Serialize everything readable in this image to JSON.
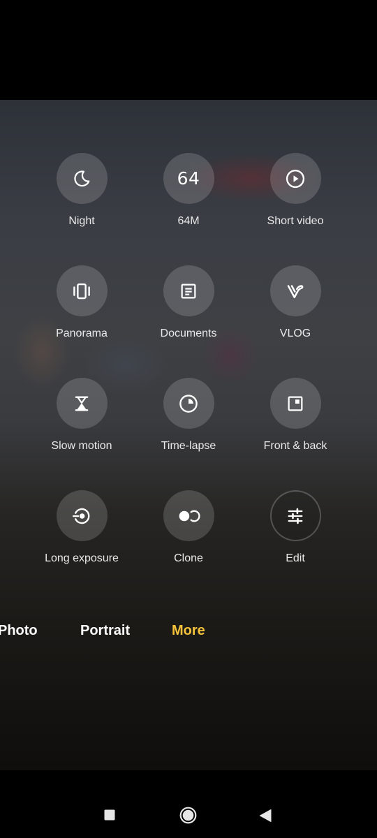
{
  "modes": [
    {
      "label": "Night",
      "icon": "moon-icon"
    },
    {
      "label": "64M",
      "icon": "64-icon",
      "icon_text": "64"
    },
    {
      "label": "Short video",
      "icon": "play-circle-icon"
    },
    {
      "label": "Panorama",
      "icon": "panorama-icon"
    },
    {
      "label": "Documents",
      "icon": "document-icon"
    },
    {
      "label": "VLOG",
      "icon": "vlog-icon"
    },
    {
      "label": "Slow motion",
      "icon": "hourglass-icon"
    },
    {
      "label": "Time-lapse",
      "icon": "timelapse-icon"
    },
    {
      "label": "Front & back",
      "icon": "front-back-icon"
    },
    {
      "label": "Long exposure",
      "icon": "long-exposure-icon"
    },
    {
      "label": "Clone",
      "icon": "clone-icon"
    },
    {
      "label": "Edit",
      "icon": "sliders-icon"
    }
  ],
  "tabs": [
    {
      "label": "Photo",
      "color": "#ffffff"
    },
    {
      "label": "Portrait",
      "color": "#ffffff"
    },
    {
      "label": "More",
      "color": "#f5c23b",
      "selected": true
    }
  ],
  "nav": {
    "recents": "square-icon",
    "home": "circle-icon",
    "back": "triangle-back-icon"
  },
  "colors": {
    "accent": "#f5c23b",
    "tile_bg": "rgba(255,255,255,0.16)"
  }
}
